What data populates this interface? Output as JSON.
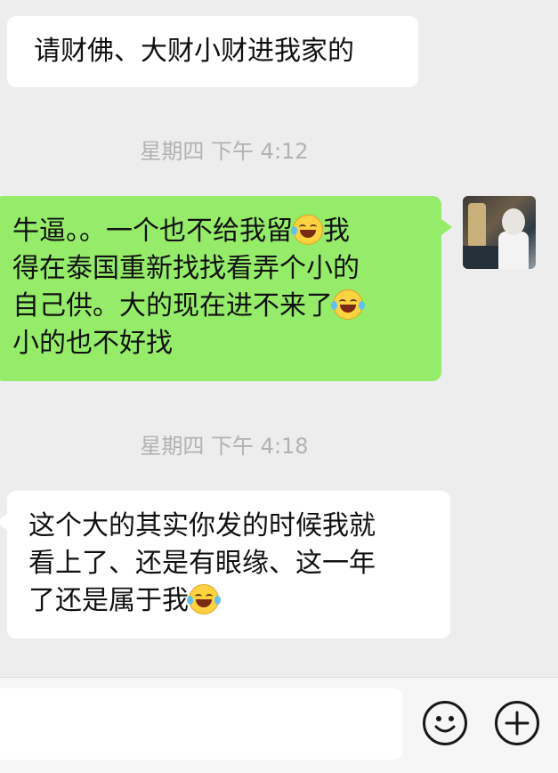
{
  "messages": [
    {
      "direction": "incoming",
      "text": "请财佛、大财小财进我家的"
    },
    {
      "direction": "outgoing",
      "lines": [
        "牛逼。。一个也不给我留",
        "我",
        "得在泰国重新找找看弄个小的",
        "自己供。大的现在进不来了",
        "小的也不好找"
      ],
      "emoji": [
        "crying-laughing",
        "tears-of-joy"
      ]
    },
    {
      "direction": "incoming",
      "lines": [
        "这个大的其实你发的时候我就",
        "看上了、还是有眼缘、这一年",
        "了还是属于我"
      ],
      "emoji": [
        "tears-of-joy"
      ]
    }
  ],
  "timestamps": [
    "星期四 下午 4:12",
    "星期四 下午 4:18"
  ],
  "input": {
    "value": "",
    "placeholder": ""
  },
  "icons": {
    "emoji_button": "smiley-face-icon",
    "more_button": "plus-circle-icon"
  },
  "colors": {
    "background": "#ededed",
    "outgoing_bubble": "#95ec69",
    "incoming_bubble": "#ffffff",
    "timestamp": "#b2b2b2"
  }
}
